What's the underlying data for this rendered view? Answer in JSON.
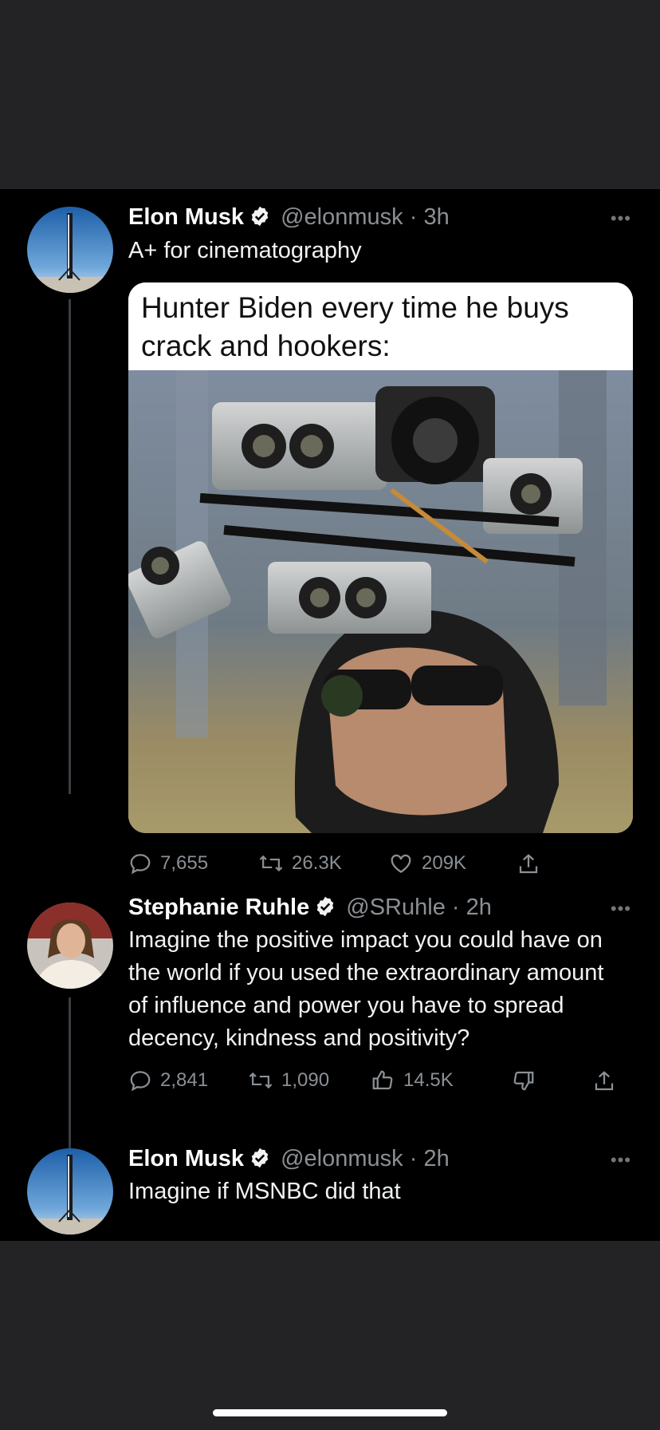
{
  "tweets": [
    {
      "name": "Elon Musk",
      "handle": "@elonmusk",
      "sep": "·",
      "time": "3h",
      "text": "A+ for cinematography",
      "meme_caption": "Hunter Biden every time he buys crack and hookers:",
      "photo_desc_icon": "camera-helmet-photo",
      "replies": "7,655",
      "retweets": "26.3K",
      "likes": "209K"
    },
    {
      "name": "Stephanie Ruhle",
      "handle": "@SRuhle",
      "sep": "·",
      "time": "2h",
      "text": "Imagine the positive impact you could have on the world if you used the extraordinary amount of influence and power you have to spread decency, kindness and positivity?",
      "replies": "2,841",
      "retweets": "1,090",
      "likes": "14.5K"
    },
    {
      "name": "Elon Musk",
      "handle": "@elonmusk",
      "sep": "·",
      "time": "2h",
      "text": "Imagine if MSNBC did that"
    }
  ],
  "more_glyph": "•••",
  "icons": [
    "verified-badge-icon",
    "reply-icon",
    "retweet-icon",
    "like-icon",
    "dislike-icon",
    "share-icon",
    "more-icon"
  ],
  "colors": {
    "background": "#000000",
    "muted": "#8b9095",
    "outer": "#232326"
  }
}
